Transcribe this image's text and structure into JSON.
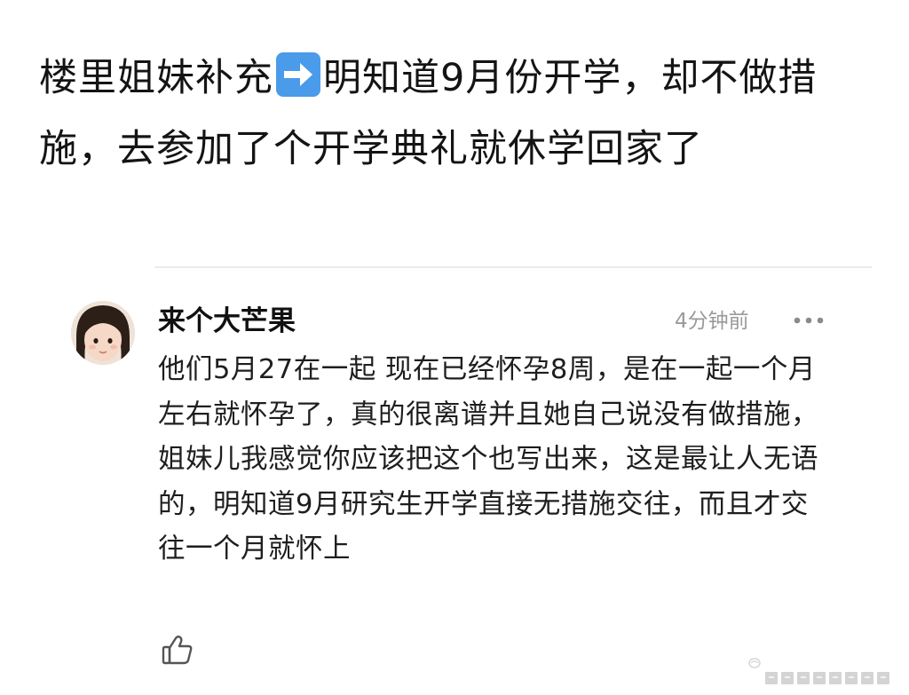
{
  "post": {
    "text_before_arrow": "楼里姐妹补充",
    "arrow_icon": "right-arrow-emoji-icon",
    "text_after_arrow": "明知道9月份开学，却不做措施，去参加了个开学典礼就休学回家了"
  },
  "comment": {
    "avatar_icon": "child-avatar",
    "username": "来个大芒果",
    "timestamp": "4分钟前",
    "more_icon": "more-dots-icon",
    "text": "他们5月27在一起 现在已经怀孕8周，是在一起一个月左右就怀孕了，真的很离谱并且她自己说没有做措施，姐妹儿我感觉你应该把这个也写出来，这是最让人无语的，明知道9月研究生开学直接无措施交往，而且才交往一个月就怀上",
    "like_icon": "thumbs-up-icon"
  },
  "colors": {
    "arrow_emoji_bg": "#4a9bea",
    "timestamp": "#9a9a9a",
    "divider": "#ececec"
  }
}
